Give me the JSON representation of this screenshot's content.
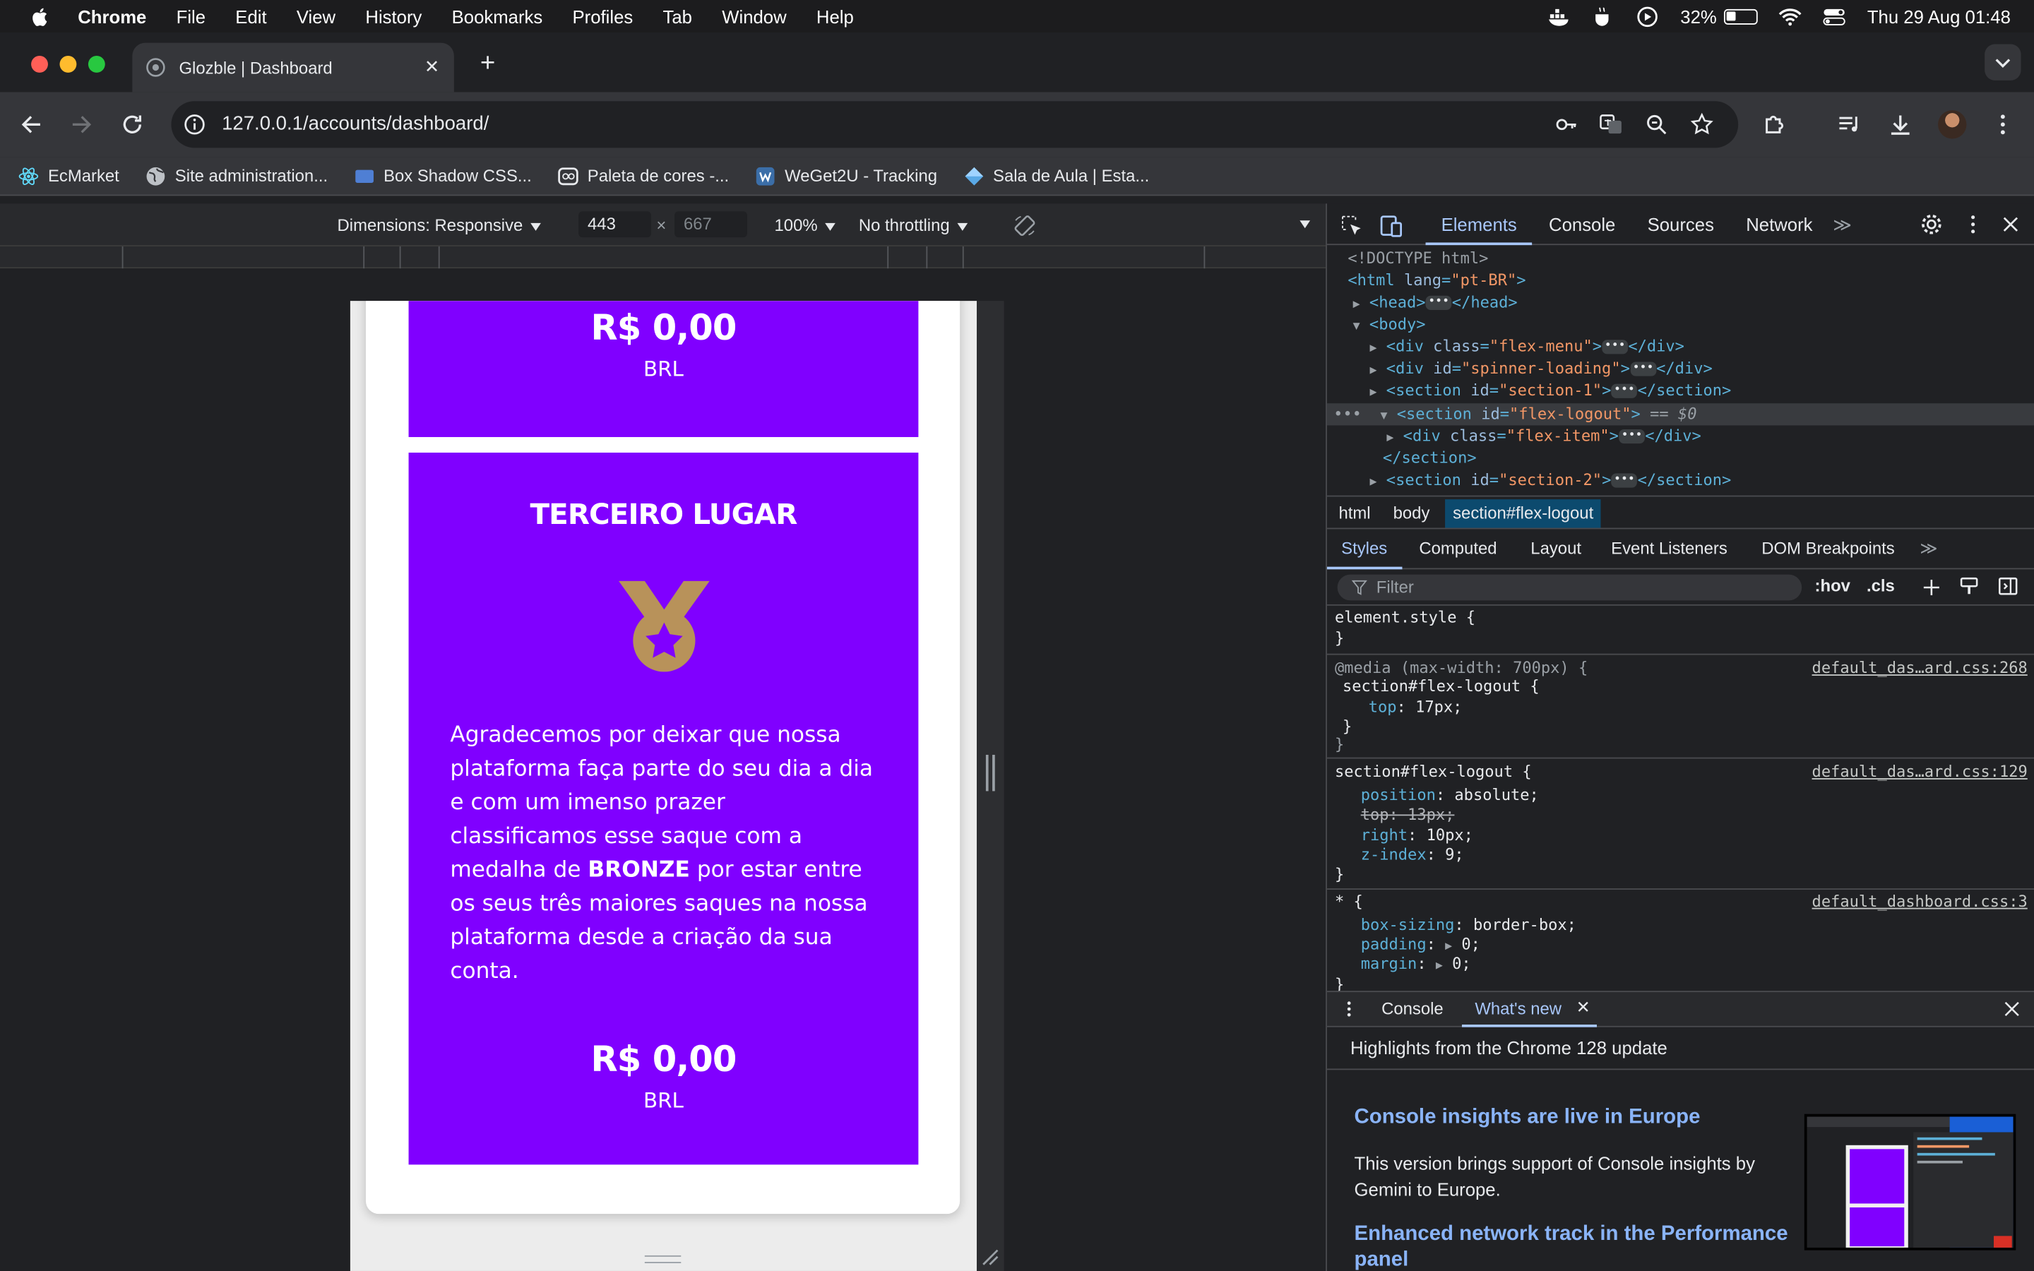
{
  "menubar": {
    "app": "Chrome",
    "items": [
      "File",
      "Edit",
      "View",
      "History",
      "Bookmarks",
      "Profiles",
      "Tab",
      "Window",
      "Help"
    ],
    "battery": "32%",
    "battery_level": 0.32,
    "datetime": "Thu 29 Aug  01:48"
  },
  "tab": {
    "title": "Glozble | Dashboard"
  },
  "toolbar": {
    "url": "127.0.0.1/accounts/dashboard/"
  },
  "bookmarks": [
    "EcMarket",
    "Site administration...",
    "Box Shadow CSS...",
    "Paleta de cores -...",
    "WeGet2U - Tracking",
    "Sala de Aula | Esta..."
  ],
  "device_toolbar": {
    "dimensions": "Dimensions: Responsive",
    "width": "443",
    "height": "667",
    "zoom": "100%",
    "throttling": "No throttling"
  },
  "page": {
    "card1": {
      "amount": "R$ 0,00",
      "currency": "BRL"
    },
    "card2": {
      "title": "TERCEIRO LUGAR",
      "text_before": "Agradecemos por deixar que nossa plataforma faça parte do seu dia a dia e com um imenso prazer classificamos esse saque com a medalha de ",
      "text_bold": "BRONZE",
      "text_after": " por estar entre os seus três maiores saques na nossa plataforma desde a criação da sua conta.",
      "amount": "R$ 0,00",
      "currency": "BRL"
    },
    "colors": {
      "card": "#8000ff",
      "medal": "#b8925a"
    }
  },
  "devtools": {
    "tabs": [
      "Elements",
      "Console",
      "Sources",
      "Network"
    ],
    "dom": {
      "doctype": "<!DOCTYPE html>",
      "html_tag": "<html",
      "html_attr": "lang",
      "html_val": "\"pt-BR\"",
      "head": "<head>",
      "head_close": "</head>",
      "body": "<body>",
      "div_tag": "<div",
      "div_close": "</div>",
      "section_tag": "<section",
      "section_close": "</section>",
      "class_attr": "class",
      "id_attr": "id",
      "flex_menu": "\"flex-menu\"",
      "spinner": "\"spinner-loading\"",
      "section1": "\"section-1\"",
      "flex_logout": "\"flex-logout\"",
      "flex_item": "\"flex-item\"",
      "section2": "\"section-2\"",
      "eq": "== $0"
    },
    "breadcrumbs": [
      "html",
      "body",
      "section#flex-logout"
    ],
    "subtabs": [
      "Styles",
      "Computed",
      "Layout",
      "Event Listeners",
      "DOM Breakpoints"
    ],
    "filter_placeholder": "Filter",
    "hov": ":hov",
    "cls": ".cls",
    "styles": {
      "element_style": "element.style {",
      "close": "}",
      "media": "@media (max-width: 700px) {",
      "selector": "section#flex-logout {",
      "universal": "* {",
      "link1": "default_das…ard.css:268",
      "link2": "default_das…ard.css:129",
      "link3": "default_dashboard.css:3",
      "top1": "top",
      "top1_val": "17px;",
      "position": "position",
      "position_val": "absolute;",
      "top2": "top: 13px;",
      "right": "right",
      "right_val": "10px;",
      "zindex": "z-index",
      "zindex_val": "9;",
      "boxsizing": "box-sizing",
      "boxsizing_val": "border-box;",
      "padding": "padding",
      "padding_val": "0;",
      "margin": "margin",
      "margin_val": "0;"
    },
    "drawer": {
      "tabs": [
        "Console",
        "What's new"
      ],
      "headline": "Highlights from the Chrome 128 update",
      "h1": "Console insights are live in Europe",
      "p1": "This version brings support of Console insights by Gemini to Europe.",
      "h2": "Enhanced network track in the Performance panel"
    }
  }
}
